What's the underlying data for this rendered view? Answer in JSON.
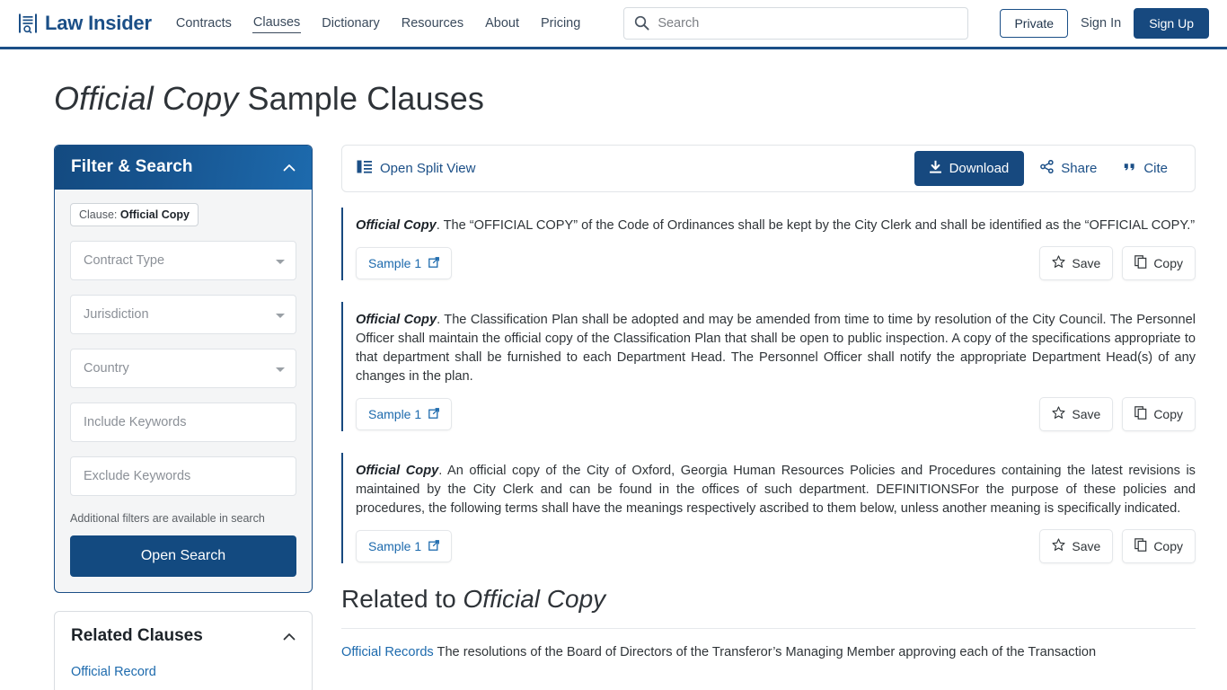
{
  "header": {
    "brand": "Law Insider",
    "brand_icon": "document-search-icon",
    "nav": [
      {
        "label": "Contracts",
        "active": false
      },
      {
        "label": "Clauses",
        "active": true
      },
      {
        "label": "Dictionary",
        "active": false
      },
      {
        "label": "Resources",
        "active": false
      },
      {
        "label": "About",
        "active": false
      },
      {
        "label": "Pricing",
        "active": false
      }
    ],
    "search": {
      "placeholder": "Search",
      "value": "",
      "icon": "search-icon"
    },
    "private_label": "Private",
    "signin_label": "Sign In",
    "signup_label": "Sign Up",
    "accent_color": "#1b4f87",
    "signup_bg": "#17497f"
  },
  "page": {
    "title_italic": "Official Copy",
    "title_rest": " Sample Clauses"
  },
  "sidebar": {
    "filter_panel": {
      "title": "Filter & Search",
      "collapse_icon": "chevron-up-icon",
      "chip_prefix": "Clause: ",
      "chip_value": "Official Copy",
      "selects": [
        {
          "label": "Contract Type"
        },
        {
          "label": "Jurisdiction"
        },
        {
          "label": "Country"
        }
      ],
      "inputs": [
        {
          "placeholder": "Include Keywords",
          "value": ""
        },
        {
          "placeholder": "Exclude Keywords",
          "value": ""
        }
      ],
      "hint": "Additional filters are available in search",
      "button_label": "Open Search",
      "header_gradient_from": "#134a80",
      "header_gradient_to": "#1d6aad"
    },
    "related_panel": {
      "title": "Related Clauses",
      "collapse_icon": "chevron-up-icon",
      "links": [
        "Official Record"
      ]
    }
  },
  "main": {
    "toolbar": {
      "split_view_label": "Open Split View",
      "split_view_icon": "split-view-icon",
      "download_label": "Download",
      "download_icon": "download-icon",
      "share_label": "Share",
      "share_icon": "share-icon",
      "cite_label": "Cite",
      "cite_icon": "quote-icon"
    },
    "clauses": [
      {
        "term": "Official Copy",
        "body": ". The “OFFICIAL COPY” of the Code of Ordinances shall be kept by the City Clerk and shall be identified as the “OFFICIAL COPY.”",
        "sample_label": "Sample 1",
        "sample_icon": "external-link-icon",
        "save_label": "Save",
        "save_icon": "star-icon",
        "copy_label": "Copy",
        "copy_icon": "copy-icon"
      },
      {
        "term": "Official Copy",
        "body": ". The Classification Plan shall be adopted and may be amended from time to time by resolution of the City Council. The Personnel Officer shall maintain the official copy of the Classification Plan that shall be open to public inspection. A copy of the specifications appropriate to that department shall be furnished to each Department Head. The Personnel Officer shall notify the appropriate Department Head(s) of any changes in the plan.",
        "sample_label": "Sample 1",
        "sample_icon": "external-link-icon",
        "save_label": "Save",
        "save_icon": "star-icon",
        "copy_label": "Copy",
        "copy_icon": "copy-icon"
      },
      {
        "term": "Official Copy",
        "body": ". An official copy of the City of Oxford, Georgia Human Resources Policies and Procedures containing the latest revisions is maintained by the City Clerk and can be found in the offices of such department. DEFINITIONSFor the purpose of these policies and procedures, the following terms shall have the meanings respectively ascribed to them below, unless another meaning is specifically indicated.",
        "sample_label": "Sample 1",
        "sample_icon": "external-link-icon",
        "save_label": "Save",
        "save_icon": "star-icon",
        "copy_label": "Copy",
        "copy_icon": "copy-icon"
      }
    ],
    "related_section": {
      "heading_prefix": "Related to ",
      "heading_italic": "Official Copy",
      "entry_link": "Official Records",
      "entry_text": " The resolutions of the Board of Directors of the Transferor’s Managing Member approving each of the Transaction"
    }
  }
}
